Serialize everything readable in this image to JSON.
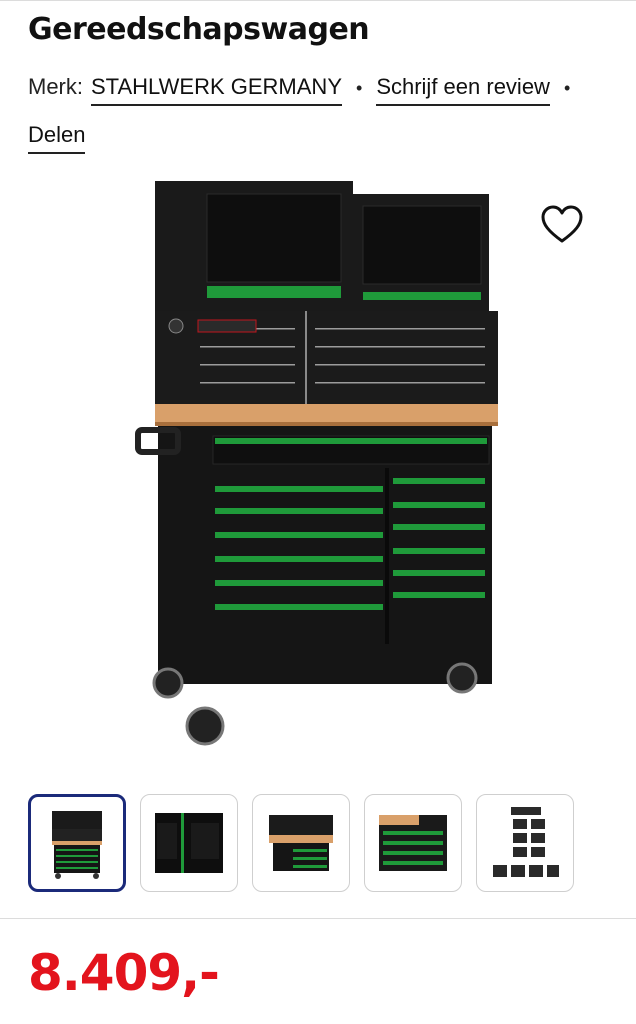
{
  "product": {
    "title": "Gereedschapswagen",
    "brand_prefix": "Merk:",
    "brand_name": "STAHLWERK GERMANY",
    "review_link": "Schrijf een review",
    "share_link": "Delen",
    "separator": "•",
    "price": "8.409,-",
    "price_color": "#e3141d"
  },
  "gallery": {
    "thumbnail_count": 5,
    "selected_index": 0,
    "selected_border_color": "#1b2a7a"
  },
  "colors": {
    "accent_green": "#1f9a3a",
    "cabinet_black": "#151515",
    "worktop_wood": "#d9a06a"
  },
  "icons": {
    "favorite": "heart-outline-icon"
  }
}
